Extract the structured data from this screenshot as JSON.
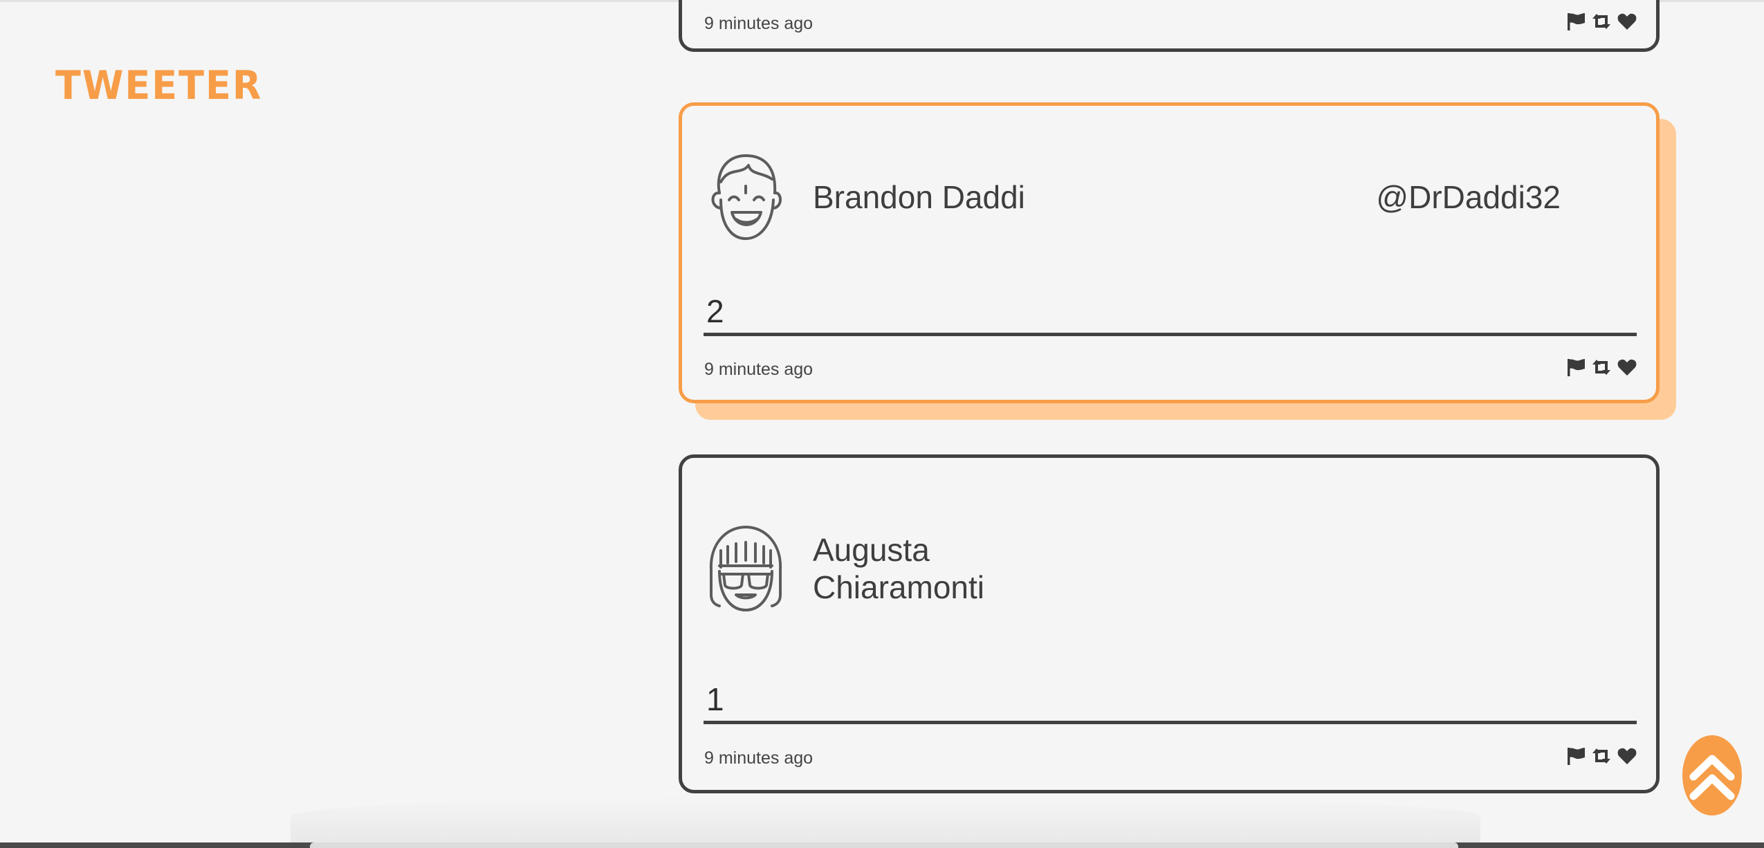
{
  "app": {
    "logo": "TWEETER"
  },
  "tweets": [
    {
      "timestamp": "9 minutes ago",
      "actions": [
        "flag-icon",
        "retweet-icon",
        "heart-icon"
      ]
    },
    {
      "name": "Brandon Daddi",
      "handle": "@DrDaddi32",
      "content": "2",
      "timestamp": "9 minutes ago",
      "avatar": "laughing-boy-avatar",
      "actions": [
        "flag-icon",
        "retweet-icon",
        "heart-icon"
      ]
    },
    {
      "name": "Augusta Chiaramonti",
      "handle": "",
      "content": "1",
      "timestamp": "9 minutes ago",
      "avatar": "girl-sunglasses-avatar",
      "actions": [
        "flag-icon",
        "retweet-icon",
        "heart-icon"
      ]
    }
  ],
  "scroll_to_top": {
    "icon": "double-chevron-up-icon"
  },
  "colors": {
    "accent": "#f79d48",
    "accent_shadow": "#ffcc99",
    "border": "#414141",
    "background": "#f5f5f5"
  }
}
